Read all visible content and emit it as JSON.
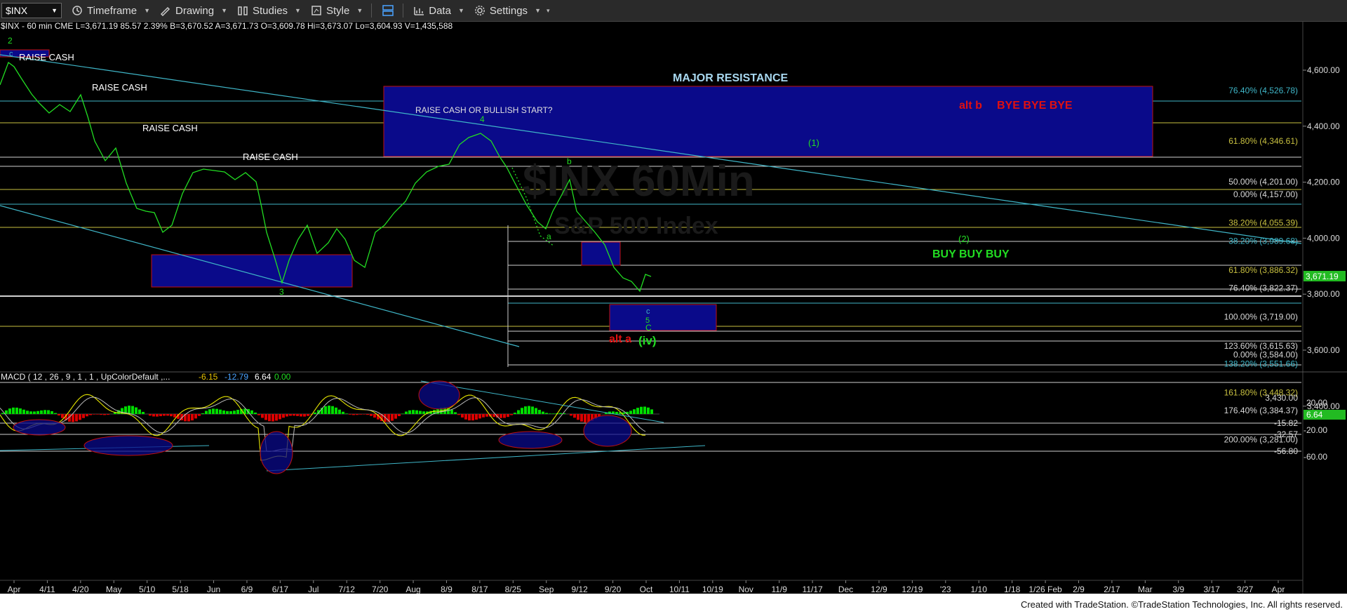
{
  "toolbar": {
    "symbol": "$INX",
    "timeframe": "Timeframe",
    "drawing": "Drawing",
    "studies": "Studies",
    "style": "Style",
    "data": "Data",
    "settings": "Settings"
  },
  "quote_line": "$INX - 60 min  CME  L=3,671.19  85.57  2.39%  B=3,670.52  A=3,671.73  O=3,609.78  Hi=3,673.07  Lo=3,604.93  V=1,435,588",
  "watermark": {
    "line1": "$INX 60Min",
    "line2": "S&P 500 Index"
  },
  "macd_header": {
    "text": "MACD ( 12 , 26 , 9 , 1 , 1 , UpColorDefault ,...",
    "v1": "-6.15",
    "v2": "-12.79",
    "v3": "6.64",
    "v4": "0.00"
  },
  "annotations": {
    "raise_cash_1": "RAISE CASH",
    "raise_cash_2": "RAISE CASH",
    "raise_cash_3": "RAISE CASH",
    "raise_cash_4": "RAISE CASH",
    "raise_cash_bullish": "RAISE CASH OR BULLISH START?",
    "major_resistance": "MAJOR RESISTANCE",
    "alt_b": "alt b",
    "bye": "BYE BYE BYE",
    "wave1": "(1)",
    "wave2": "(2)",
    "buy": "BUY BUY BUY",
    "alt_a": "alt a",
    "wave_iv": "(iv)",
    "w4": "4",
    "w3": "3",
    "w2": "2",
    "wc_top": "c",
    "wa": "a",
    "wb": "b",
    "wc": "c",
    "w5": "5",
    "wC": "C"
  },
  "fib_labels": [
    {
      "text": "76.40% (4,526.78)",
      "color": "#3fb6c8"
    },
    {
      "text": "61.80% (4,346.61)",
      "color": "#c8c040"
    },
    {
      "text": "50.00% (4,201.00)",
      "color": "#d8d8d8"
    },
    {
      "text": "0.00% (4,157.00)",
      "color": "#d8d8d8"
    },
    {
      "text": "38.20% (4,055.39)",
      "color": "#c8c040"
    },
    {
      "text": "38.20% (3,989.68)",
      "color": "#3fb6c8"
    },
    {
      "text": "61.80% (3,886.32)",
      "color": "#c8c040"
    },
    {
      "text": "76.40% (3,822.37)",
      "color": "#d8d8d8"
    },
    {
      "text": "100.00% (3,719.00)",
      "color": "#d8d8d8"
    },
    {
      "text": "123.60% (3,615.63)",
      "color": "#d8d8d8"
    },
    {
      "text": "0.00% (3,584.00)",
      "color": "#d8d8d8"
    },
    {
      "text": "138.20% (3,551.66)",
      "color": "#3fb6c8"
    },
    {
      "text": "161.80% (3,448.32)",
      "color": "#c8c040"
    },
    {
      "text": "3,430.00",
      "color": "#d8d8d8"
    },
    {
      "text": "176.40% (3,384.37)",
      "color": "#d8d8d8"
    },
    {
      "text": "200.00% (3,281.00)",
      "color": "#d8d8d8"
    }
  ],
  "price_axis": [
    "4,600.00",
    "4,400.00",
    "4,200.00",
    "4,000.00",
    "3,800.00",
    "3,600.00",
    "3,400.00"
  ],
  "last_price": "3,671.19",
  "macd_axis": [
    "20.00",
    "-20.00",
    "-60.00"
  ],
  "macd_levels": [
    "-15.82",
    "-32.57",
    "-56.80"
  ],
  "macd_last": "6.64",
  "time_axis": [
    "Apr",
    "4/11",
    "4/20",
    "May",
    "5/10",
    "5/18",
    "Jun",
    "6/9",
    "6/17",
    "Jul",
    "7/12",
    "7/20",
    "Aug",
    "8/9",
    "8/17",
    "8/25",
    "Sep",
    "9/12",
    "9/20",
    "Oct",
    "10/11",
    "10/19",
    "Nov",
    "11/9",
    "11/17",
    "Dec",
    "12/9",
    "12/19",
    "'23",
    "1/10",
    "1/18",
    "1/26 Feb",
    "2/9",
    "2/17",
    "Mar",
    "3/9",
    "3/17",
    "3/27",
    "Apr"
  ],
  "footer": "Created with TradeStation. ©TradeStation Technologies, Inc. All rights reserved.",
  "colors": {
    "background": "#000000",
    "price": "#22dd22",
    "zone": "#0a0a8a",
    "zone_border": "#c01010",
    "trendline": "#3fb6c8",
    "macd_up": "#00dd00",
    "macd_down": "#dd0000"
  }
}
